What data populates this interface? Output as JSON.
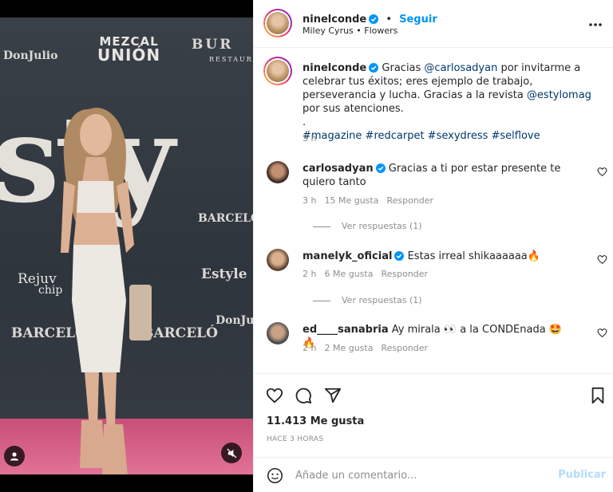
{
  "media": {
    "backdrop_logos": [
      "DonJulio",
      "MEZCAL",
      "UNIÓN",
      "BUR",
      "RESTAURA",
      "BARCELÓ",
      "Rejuv",
      "chip",
      "Estyle",
      "BARCELÓ",
      "DonJulio",
      "BARCELÓ",
      "sty"
    ],
    "user_button_icon": "user-icon",
    "mute_button_icon": "mute-icon"
  },
  "header": {
    "username": "ninelconde",
    "separator": "•",
    "follow_label": "Seguir",
    "song": "Miley Cyrus • Flowers",
    "more_icon": "more-horizontal-icon"
  },
  "caption": {
    "username": "ninelconde",
    "text_parts": [
      "Gracias ",
      "@carlosadyan",
      " por invitarme a celebrar tus éxitos; eres ejemplo de trabajo, perseverancia y lucha. Gracias a la revista ",
      "@estylomag",
      " por sus atenciones."
    ],
    "dot": ".",
    "hashtags": "#magazine #redcarpet #sexydress #selflove",
    "time": "3 h"
  },
  "comments": [
    {
      "username": "carlosadyan",
      "verified": true,
      "text": "Gracias a ti por estar presente te quiero tanto",
      "time": "3 h",
      "likes": "15 Me gusta",
      "reply": "Responder",
      "view_replies": "Ver respuestas (1)"
    },
    {
      "username": "manelyk_oficial",
      "verified": true,
      "text": "Estas irreal shikaaaaaa🔥",
      "time": "2 h",
      "likes": "6 Me gusta",
      "reply": "Responder",
      "view_replies": "Ver respuestas (1)"
    },
    {
      "username": "ed____sanabria",
      "verified": false,
      "text": "Ay mirala 👀 a la CONDEnada 🤩🔥",
      "time": "2 h",
      "likes": "2 Me gusta",
      "reply": "Responder"
    }
  ],
  "actions": {
    "likes": "11.413 Me gusta",
    "date": "HACE 3 HORAS"
  },
  "add_comment": {
    "placeholder": "Añade un comentario...",
    "publish_label": "Publicar"
  },
  "colors": {
    "accent": "#0095f6",
    "text": "#262626",
    "muted": "#8e8e8e",
    "link": "#00376b",
    "carpet": "#d45f86"
  }
}
